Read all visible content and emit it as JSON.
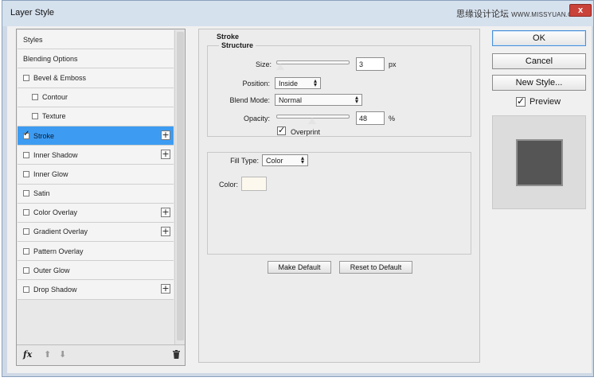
{
  "window": {
    "title": "Layer Style",
    "watermark": "思缘设计论坛",
    "watermark_site": "WWW.MISSYUAN.COM",
    "close_glyph": "x"
  },
  "styles_list": [
    {
      "label": "Styles",
      "checkbox": false,
      "checked": false,
      "plus": false,
      "selected": false,
      "sub": false
    },
    {
      "label": "Blending Options",
      "checkbox": false,
      "checked": false,
      "plus": false,
      "selected": false,
      "sub": false
    },
    {
      "label": "Bevel & Emboss",
      "checkbox": true,
      "checked": false,
      "plus": false,
      "selected": false,
      "sub": false
    },
    {
      "label": "Contour",
      "checkbox": true,
      "checked": false,
      "plus": false,
      "selected": false,
      "sub": true
    },
    {
      "label": "Texture",
      "checkbox": true,
      "checked": false,
      "plus": false,
      "selected": false,
      "sub": true
    },
    {
      "label": "Stroke",
      "checkbox": true,
      "checked": true,
      "plus": true,
      "selected": true,
      "sub": false
    },
    {
      "label": "Inner Shadow",
      "checkbox": true,
      "checked": false,
      "plus": true,
      "selected": false,
      "sub": false
    },
    {
      "label": "Inner Glow",
      "checkbox": true,
      "checked": false,
      "plus": false,
      "selected": false,
      "sub": false
    },
    {
      "label": "Satin",
      "checkbox": true,
      "checked": false,
      "plus": false,
      "selected": false,
      "sub": false
    },
    {
      "label": "Color Overlay",
      "checkbox": true,
      "checked": false,
      "plus": true,
      "selected": false,
      "sub": false
    },
    {
      "label": "Gradient Overlay",
      "checkbox": true,
      "checked": false,
      "plus": true,
      "selected": false,
      "sub": false
    },
    {
      "label": "Pattern Overlay",
      "checkbox": true,
      "checked": false,
      "plus": false,
      "selected": false,
      "sub": false
    },
    {
      "label": "Outer Glow",
      "checkbox": true,
      "checked": false,
      "plus": false,
      "selected": false,
      "sub": false
    },
    {
      "label": "Drop Shadow",
      "checkbox": true,
      "checked": false,
      "plus": true,
      "selected": false,
      "sub": false
    }
  ],
  "footer": {
    "fx_label": "fx",
    "up_glyph": "⬆",
    "down_glyph": "⬇"
  },
  "stroke": {
    "section_title": "Stroke",
    "structure_label": "Structure",
    "size_label": "Size:",
    "size_value": "3",
    "size_unit": "px",
    "size_slider_fraction": 0.01,
    "position_label": "Position:",
    "position_value": "Inside",
    "blend_mode_label": "Blend Mode:",
    "blend_mode_value": "Normal",
    "opacity_label": "Opacity:",
    "opacity_value": "48",
    "opacity_unit": "%",
    "opacity_slider_fraction": 0.48,
    "overprint_label": "Overprint",
    "overprint_checked": true,
    "fill_type_label": "Fill Type:",
    "fill_type_value": "Color",
    "color_label": "Color:",
    "color_value": "#fcf8ee",
    "make_default_label": "Make Default",
    "reset_default_label": "Reset to Default"
  },
  "dropdown_caret": "▴\n▾",
  "buttons": {
    "ok": "OK",
    "cancel": "Cancel",
    "new_style": "New Style..."
  },
  "preview": {
    "label": "Preview",
    "checked": true
  },
  "colors": {
    "selected_row": "#3d9cf2",
    "preview_shape": "#555555"
  }
}
